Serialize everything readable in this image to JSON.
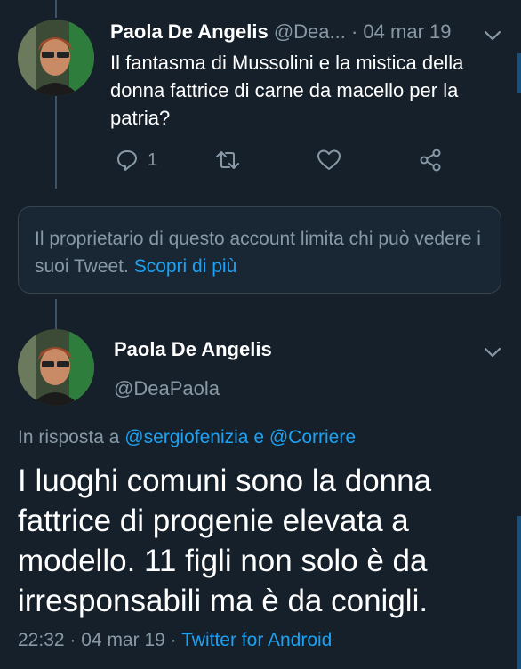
{
  "tweet1": {
    "name": "Paola De Angelis",
    "handle": "@Dea...",
    "separator": "·",
    "date": "04 mar 19",
    "text": "Il fantasma di Mussolini e la mistica della donna fattrice di carne da macello per la patria?",
    "reply_count": "1",
    "icons": [
      "reply-icon",
      "retweet-icon",
      "like-icon",
      "share-icon",
      "chevron-down-icon"
    ]
  },
  "notice": {
    "text": "Il proprietario di questo account limita chi può vedere i suoi Tweet.",
    "link": "Scopri di più"
  },
  "tweet2": {
    "name": "Paola De Angelis",
    "handle": "@DeaPaola",
    "reply_prefix": "In risposta a",
    "reply_user1": "@sergiofenizia",
    "reply_and": "e",
    "reply_user2": "@Corriere",
    "text": "I luoghi comuni sono la donna fattrice di progenie elevata a modello. 11 figli non solo è da irresponsabili ma è da conigli.",
    "time": "22:32",
    "separator": "·",
    "date": "04 mar 19",
    "client": "Twitter for Android"
  },
  "colors": {
    "background": "#15202b",
    "muted": "#8899a6",
    "link": "#1da1f2",
    "border": "#38444d"
  }
}
